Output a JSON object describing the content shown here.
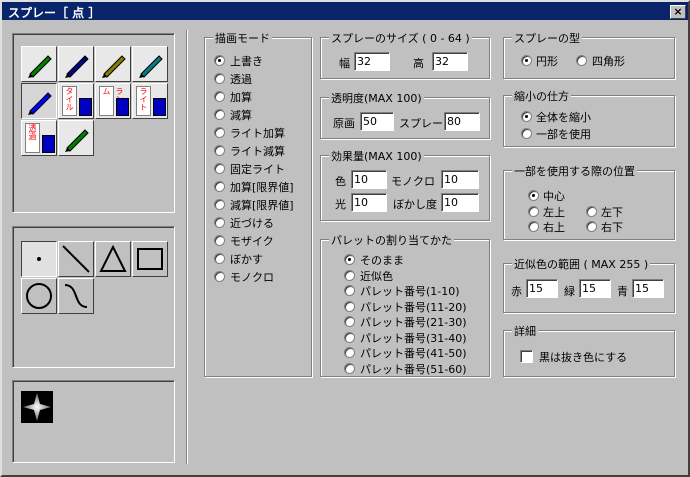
{
  "window": {
    "title": "スプレー［ 点 ］",
    "close": "×"
  },
  "tools": [
    {
      "name": "pen-tool-icon",
      "fg": "#008000"
    },
    {
      "name": "dropper-tool-icon",
      "fg": "#000080"
    },
    {
      "name": "eraser-tool-icon",
      "fg": "#808000"
    },
    {
      "name": "bucket-fill-tool-icon",
      "fg": "#008080"
    },
    {
      "name": "spray-tool-icon",
      "fg": "#0000ff"
    },
    {
      "name": "tile-spray-tool-icon",
      "label": "タイル",
      "fg": "#ff0000"
    },
    {
      "name": "random-spray-tool-icon",
      "label": "ランダム",
      "fg": "#ff0000"
    },
    {
      "name": "light-spray-tool-icon",
      "label": "ライト",
      "fg": "#ff0000"
    },
    {
      "name": "transparent-spray-tool-icon",
      "label": "透過",
      "fg": "#ff0000"
    },
    {
      "name": "brush-tool-icon",
      "fg": "#008000"
    }
  ],
  "shapes": [
    "dot-shape-icon",
    "line-shape-icon",
    "triangle-shape-icon",
    "rectangle-shape-icon",
    "circle-shape-icon",
    "curve-shape-icon"
  ],
  "draw_mode": {
    "title": "描画モード",
    "options": [
      "上書き",
      "透過",
      "加算",
      "減算",
      "ライト加算",
      "ライト減算",
      "固定ライト",
      "加算[限界値]",
      "減算[限界値]",
      "近づける",
      "モザイク",
      "ぼかす",
      "モノクロ"
    ],
    "selected": 0
  },
  "size": {
    "title": "スプレーのサイズ ( 0 - 64 )",
    "w_label": "幅",
    "w": "32",
    "h_label": "高",
    "h": "32"
  },
  "opacity": {
    "title": "透明度(MAX 100)",
    "orig_label": "原画",
    "orig": "50",
    "spray_label": "スプレー",
    "spray": "80"
  },
  "effect": {
    "title": "効果量(MAX 100)",
    "color_label": "色",
    "color": "10",
    "mono_label": "モノクロ",
    "mono": "10",
    "light_label": "光",
    "light": "10",
    "blur_label": "ぼかし度",
    "blur": "10"
  },
  "palette": {
    "title": "パレットの割り当てかた",
    "options": [
      "そのまま",
      "近似色",
      "パレット番号(1-10)",
      "パレット番号(11-20)",
      "パレット番号(21-30)",
      "パレット番号(31-40)",
      "パレット番号(41-50)",
      "パレット番号(51-60)"
    ],
    "selected": 0
  },
  "spray_type": {
    "title": "スプレーの型",
    "options": [
      "円形",
      "四角形"
    ],
    "selected": 0
  },
  "shrink": {
    "title": "縮小の仕方",
    "options": [
      "全体を縮小",
      "一部を使用"
    ],
    "selected": 0
  },
  "position": {
    "title": "一部を使用する際の位置",
    "options": [
      "中心",
      "左上",
      "右上",
      "左下",
      "右下"
    ],
    "selected": 0
  },
  "similar": {
    "title": "近似色の範囲 ( MAX 255 )",
    "r_label": "赤",
    "r": "15",
    "g_label": "緑",
    "g": "15",
    "b_label": "青",
    "b": "15"
  },
  "detail": {
    "title": "詳細",
    "checkbox_label": "黒は抜き色にする"
  }
}
